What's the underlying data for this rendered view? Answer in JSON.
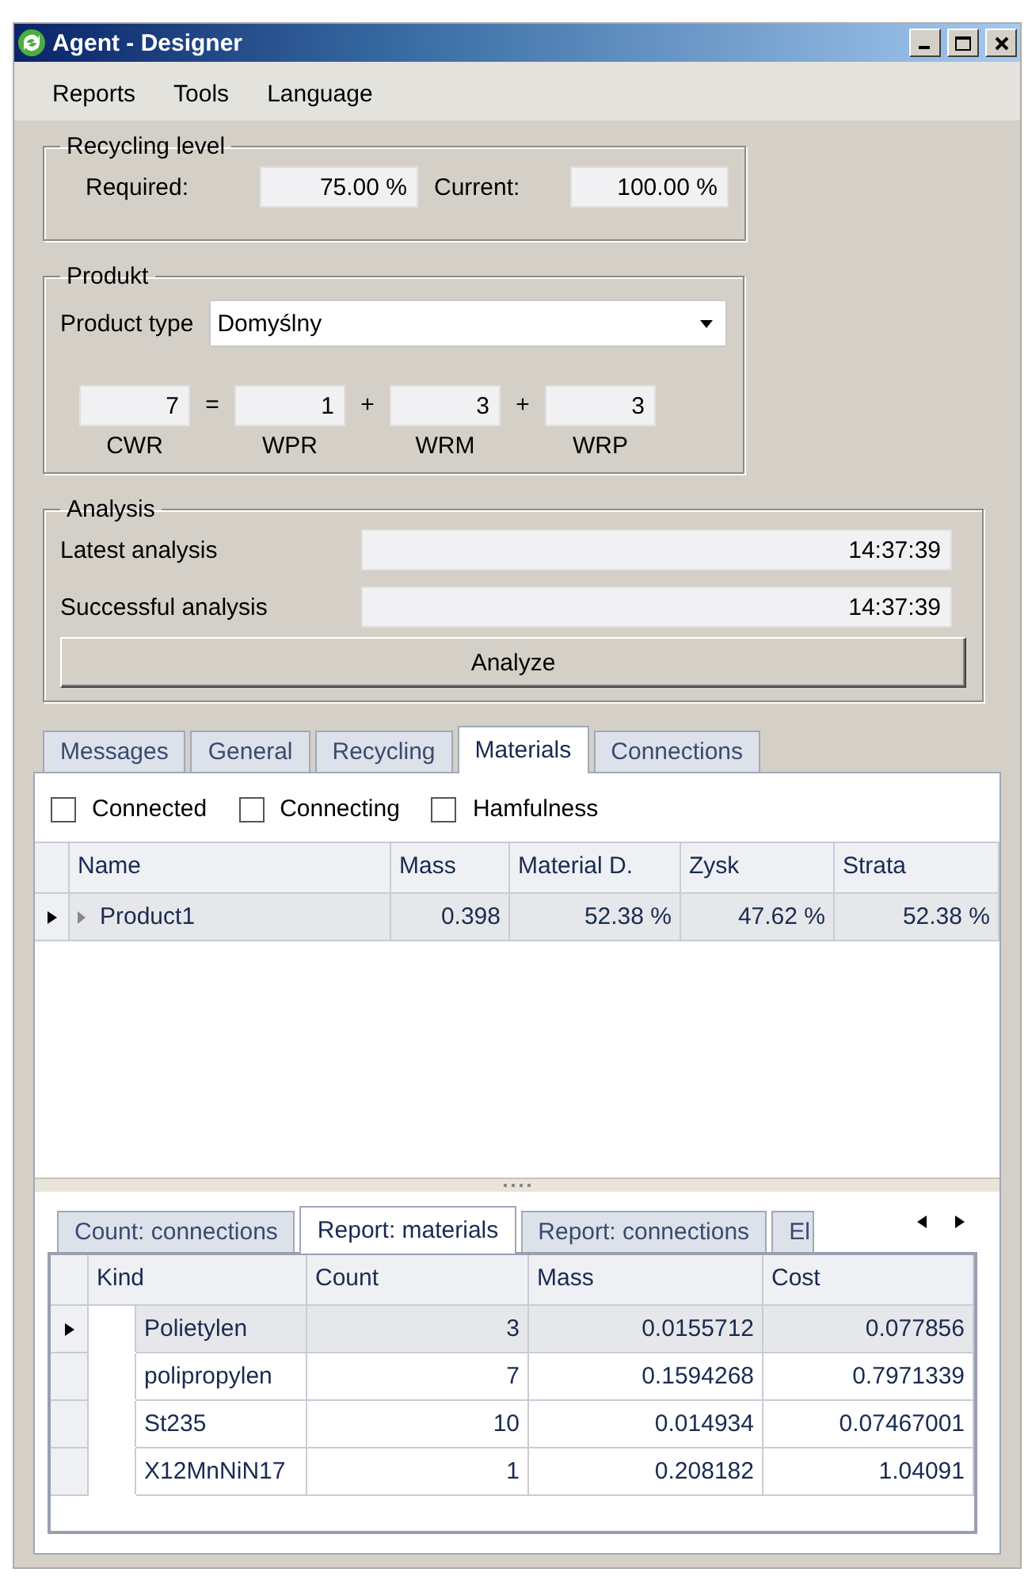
{
  "window": {
    "title": "Agent - Designer"
  },
  "menu": [
    "Reports",
    "Tools",
    "Language"
  ],
  "recycling_level": {
    "title": "Recycling level",
    "fields": [
      {
        "label": "Required:",
        "value": "75.00 %"
      },
      {
        "label": "Current:",
        "value": "100.00 %"
      }
    ]
  },
  "product": {
    "title": "Produkt",
    "type_label": "Product type",
    "type_value": "Domyślny",
    "terms": [
      {
        "value": "7",
        "label": "CWR"
      },
      {
        "operator": "=",
        "value": "1",
        "label": "WPR"
      },
      {
        "operator": "+",
        "value": "3",
        "label": "WRM"
      },
      {
        "operator": "+",
        "value": "3",
        "label": "WRP"
      }
    ]
  },
  "analysis": {
    "title": "Analysis",
    "rows": [
      {
        "label": "Latest analysis",
        "value": "14:37:39"
      },
      {
        "label": "Successful analysis",
        "value": "14:37:39"
      }
    ],
    "button": "Analyze"
  },
  "tabs": [
    {
      "label": "Messages",
      "selected": false
    },
    {
      "label": "General",
      "selected": false
    },
    {
      "label": "Recycling",
      "selected": false
    },
    {
      "label": "Materials",
      "selected": true
    },
    {
      "label": "Connections",
      "selected": false
    }
  ],
  "filters": [
    {
      "label": "Connected",
      "checked": false
    },
    {
      "label": "Connecting",
      "checked": false
    },
    {
      "label": "Hamfulness",
      "checked": false
    }
  ],
  "materials_table": {
    "columns": [
      "Name",
      "Mass",
      "Material D.",
      "Zysk",
      "Strata"
    ],
    "rows": [
      {
        "selected": true,
        "expanded": false,
        "cells": [
          "Product1",
          "0.398",
          "52.38 %",
          "47.62 %",
          "52.38 %"
        ]
      }
    ]
  },
  "report_tabs": [
    {
      "label": "Count: connections",
      "selected": false
    },
    {
      "label": "Report: materials",
      "selected": true
    },
    {
      "label": "Report: connections",
      "selected": false
    },
    {
      "label": "El",
      "selected": false
    }
  ],
  "report_table": {
    "columns": [
      "Kind",
      "Count",
      "Mass",
      "Cost"
    ],
    "rows": [
      {
        "selected": true,
        "cells": [
          "Polietylen",
          "3",
          "0.0155712",
          "0.077856"
        ]
      },
      {
        "selected": false,
        "cells": [
          "polipropylen",
          "7",
          "0.1594268",
          "0.7971339"
        ]
      },
      {
        "selected": false,
        "cells": [
          "St235",
          "10",
          "0.014934",
          "0.07467001"
        ]
      },
      {
        "selected": false,
        "cells": [
          "X12MnNiN17",
          "1",
          "0.208182",
          "1.04091"
        ]
      }
    ]
  }
}
